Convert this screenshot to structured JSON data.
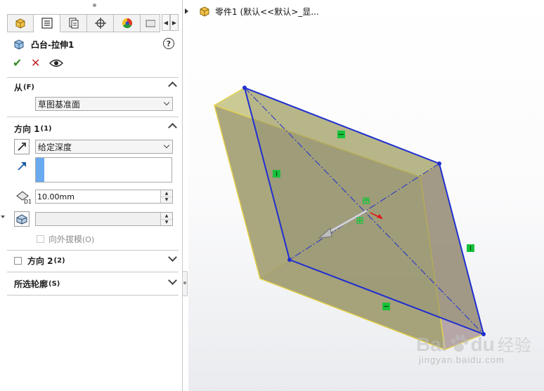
{
  "tree": {
    "root_label": "零件1  (默认<<默认>_显..."
  },
  "feature": {
    "title": "凸台-拉伸1",
    "help": "?"
  },
  "tabs": [
    {
      "name": "feature-manager",
      "icon": "part-cube-icon"
    },
    {
      "name": "property-manager",
      "icon": "property-list-icon"
    },
    {
      "name": "configuration-manager",
      "icon": "configuration-icon"
    },
    {
      "name": "dim-xpert",
      "icon": "crosshair-icon"
    },
    {
      "name": "display-manager",
      "icon": "color-wheel-icon"
    }
  ],
  "from": {
    "label": "从",
    "key": "(F)",
    "value": "草图基准面"
  },
  "direction1": {
    "label": "方向 1",
    "key": "(1)",
    "end_condition": "给定深度",
    "depth": "10.00mm",
    "draft_outward": "向外拔模",
    "draft_key": "(O)"
  },
  "direction2": {
    "label": "方向 2",
    "key": "(2)"
  },
  "contours": {
    "label": "所选轮廓",
    "key": "(S)"
  },
  "watermark": {
    "brand": "Bai",
    "brand2": "du",
    "brand_cn": "经验",
    "url": "jingyan.baidu.com"
  },
  "colors": {
    "sketch": "#1f2fcf",
    "extrude_edge": "#e6d44a",
    "relation_marker": "#18c23c",
    "selection": "#6aaaf0"
  }
}
